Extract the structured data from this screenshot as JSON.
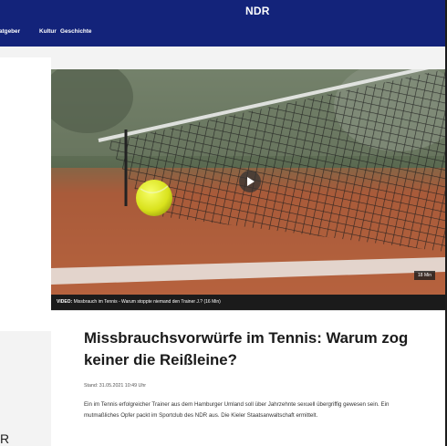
{
  "header": {
    "logo_text": "NDR",
    "nav_items": [
      "atgeber",
      "Kultur",
      "Geschichte"
    ],
    "brand_color": "#13237a"
  },
  "video": {
    "play_icon": "play-icon",
    "duration": "18 Min",
    "caption_label": "VIDEO:",
    "caption_text": "Missbrauch im Tennis - Warum stoppte niemand den Trainer J.? (16 Min)"
  },
  "article": {
    "headline": "Missbrauchsvorwürfe im Tennis: Warum zog keiner die Reißleine?",
    "date": "Stand: 31.05.2021 10:49 Uhr",
    "teaser": "Ein im Tennis erfolgreicher Trainer aus dem Hamburger Umland soll über Jahrzehnte sexuell übergriffig gewesen sein. Ein mutmaßliches Opfer packt im Sportclub des NDR aus. Die Kieler Staatsanwaltschaft ermittelt."
  },
  "misc": {
    "cut_glyph": "R"
  }
}
